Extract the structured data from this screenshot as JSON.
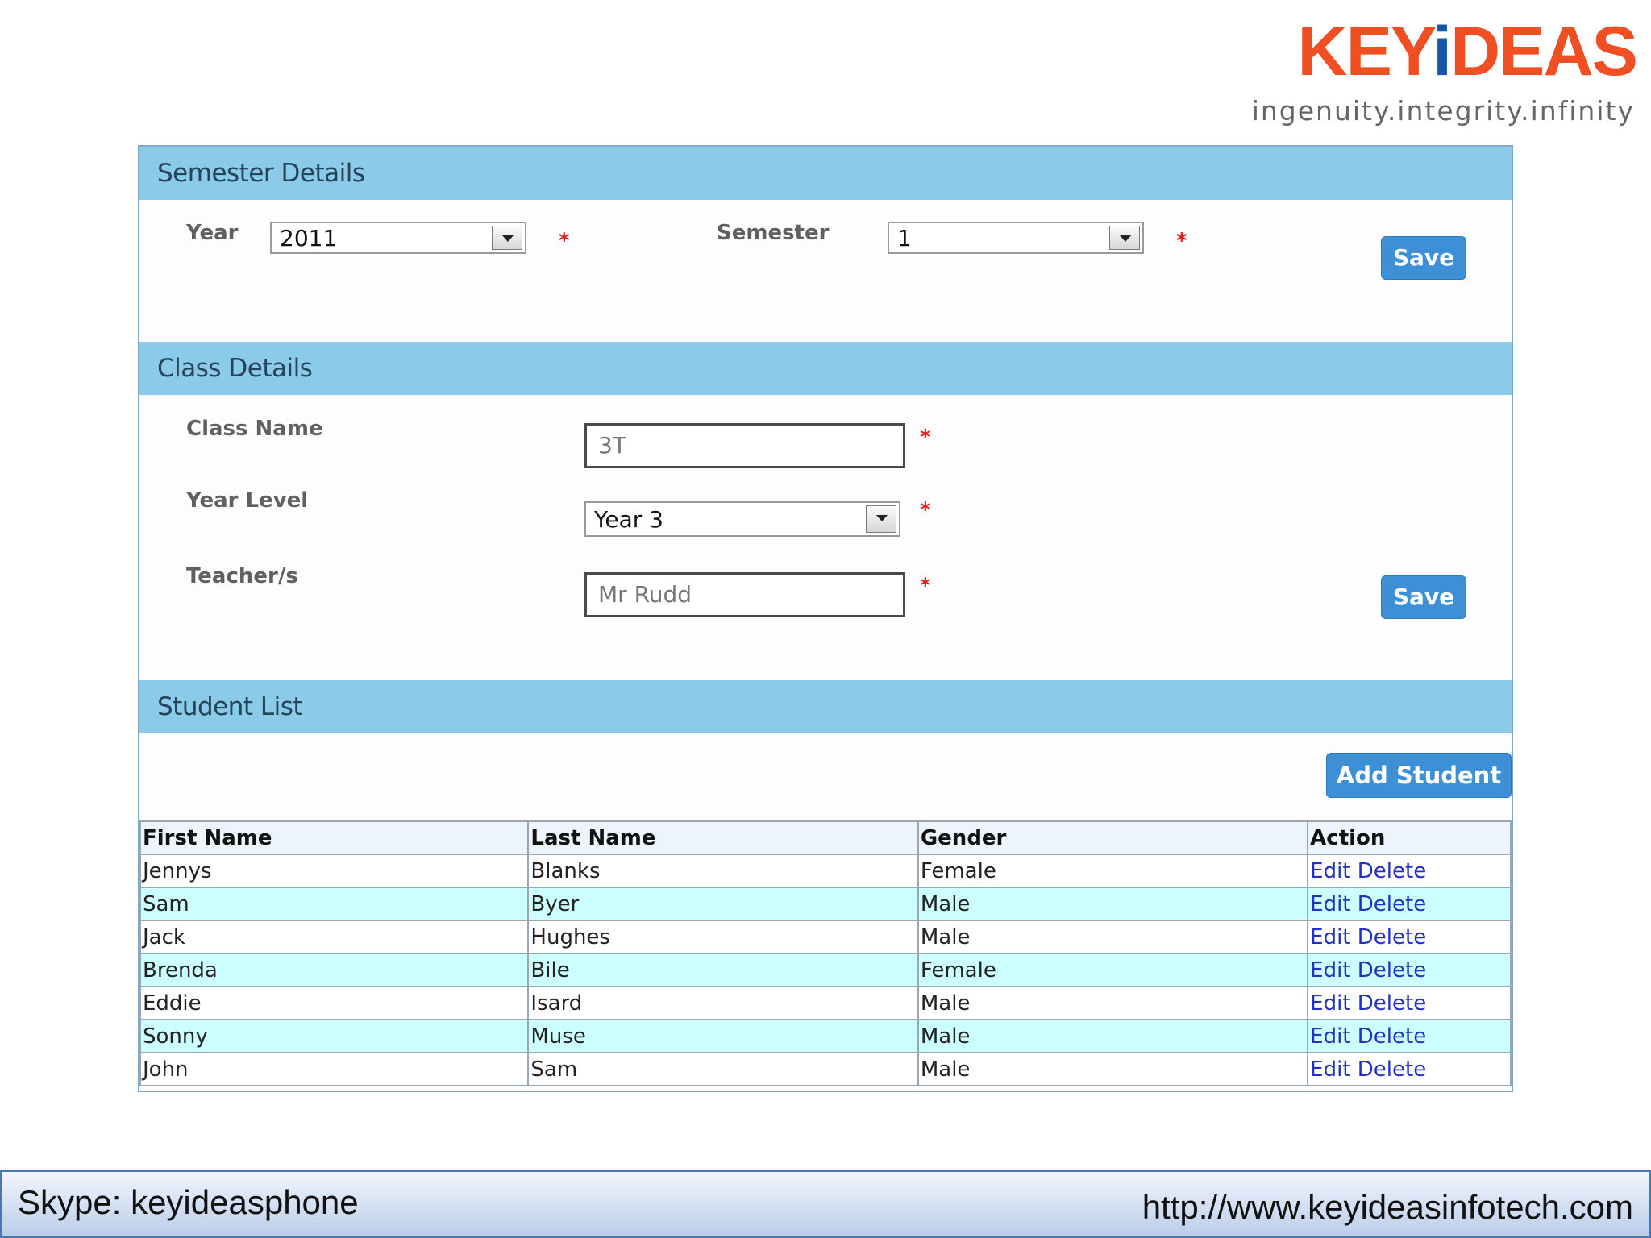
{
  "brand": {
    "logo_text_pre": "KEY",
    "logo_text_i": "i",
    "logo_text_post": "DEAS",
    "tagline": "ingenuity.integrity.infinity",
    "orange": "#f04e23",
    "blue": "#1756a9"
  },
  "semester": {
    "title": "Semester Details",
    "year_label": "Year",
    "year_value": "2011",
    "semester_label": "Semester",
    "semester_value": "1",
    "required_mark": "*",
    "save_label": "Save"
  },
  "class": {
    "title": "Class Details",
    "class_name_label": "Class Name",
    "class_name_value": "3T",
    "year_level_label": "Year Level",
    "year_level_value": "Year 3",
    "teacher_label": "Teacher/s",
    "teacher_value": "Mr Rudd",
    "required_mark": "*",
    "save_label": "Save"
  },
  "students": {
    "title": "Student List",
    "add_label": "Add Student",
    "columns": [
      "First Name",
      "Last Name",
      "Gender",
      "Action"
    ],
    "edit_label": "Edit",
    "delete_label": "Delete",
    "rows": [
      {
        "first": "Jennys",
        "last": "Blanks",
        "gender": "Female"
      },
      {
        "first": "Sam",
        "last": "Byer",
        "gender": "Male"
      },
      {
        "first": "Jack",
        "last": "Hughes",
        "gender": "Male"
      },
      {
        "first": "Brenda",
        "last": "Bile",
        "gender": "Female"
      },
      {
        "first": "Eddie",
        "last": "Isard",
        "gender": "Male"
      },
      {
        "first": "Sonny",
        "last": "Muse",
        "gender": "Male"
      },
      {
        "first": "John",
        "last": "Sam",
        "gender": "Male"
      }
    ]
  },
  "footer": {
    "skype": "Skype: keyideasphone",
    "url": "http://www.keyideasinfotech.com"
  },
  "colors": {
    "section_header": "#8bcbea",
    "button": "#3d8fd6",
    "alt_row": "#ccffff",
    "required": "#e02020"
  }
}
